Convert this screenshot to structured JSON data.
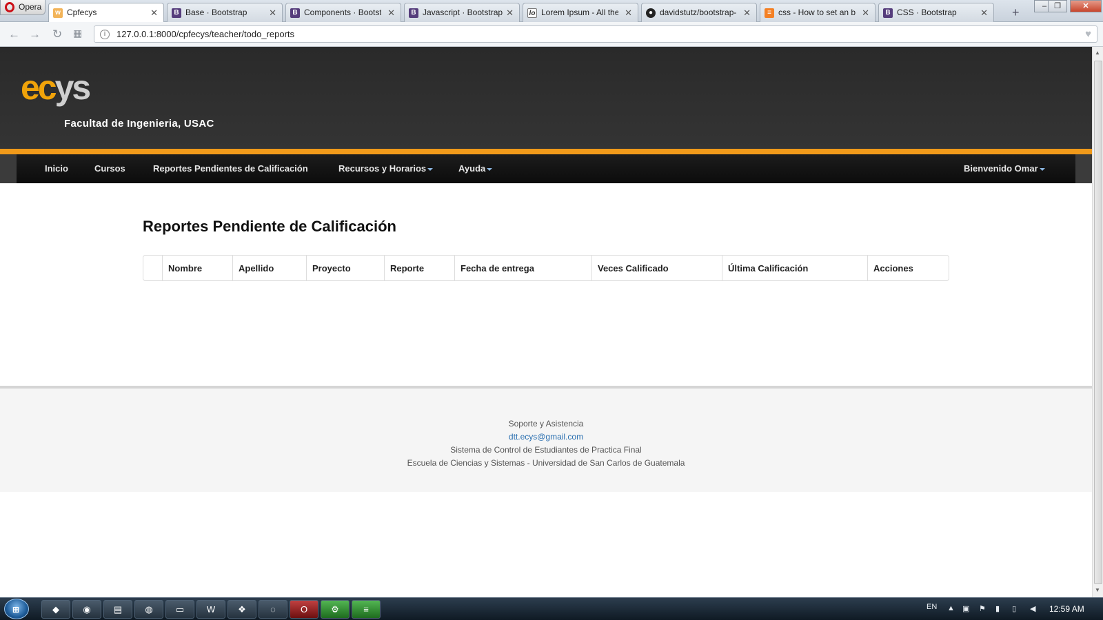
{
  "browser": {
    "menu_label": "Opera",
    "tabs": [
      {
        "title": "Cpfecys",
        "favicon": "wsp"
      },
      {
        "title": "Base · Bootstrap",
        "favicon": "B"
      },
      {
        "title": "Components · Bootstrap",
        "favicon": "B"
      },
      {
        "title": "Javascript · Bootstrap",
        "favicon": "B"
      },
      {
        "title": "Lorem Ipsum - All the facts",
        "favicon": "lor"
      },
      {
        "title": "davidstutz/bootstrap-multiselect",
        "favicon": "github"
      },
      {
        "title": "css - How to set an button",
        "favicon": "stackoverflow"
      },
      {
        "title": "CSS · Bootstrap",
        "favicon": "B"
      }
    ],
    "new_tab_icon": "+",
    "url": "127.0.0.1:8000/cpfecys/teacher/todo_reports"
  },
  "header": {
    "logo_accent": "ec",
    "logo_rest": "ys",
    "subtitle": "Facultad de Ingenieria, USAC",
    "accent_color": "#f19a1a"
  },
  "nav": {
    "items": [
      {
        "label": "Inicio"
      },
      {
        "label": "Cursos"
      },
      {
        "label": "Reportes Pendientes de Calificación"
      },
      {
        "label": "Recursos y Horarios"
      },
      {
        "label": "Ayuda"
      }
    ],
    "user_menu": "Bienvenido Omar"
  },
  "main": {
    "title": "Reportes Pendiente de Calificación",
    "table": {
      "headers": [
        "",
        "Nombre",
        "Apellido",
        "Proyecto",
        "Reporte",
        "Fecha de entrega",
        "Veces Calificado",
        "Última Calificación",
        "Acciones"
      ]
    }
  },
  "footer": {
    "line1": "Soporte y Asistencia",
    "email": "dtt.ecys@gmail.com",
    "line3": "Sistema de Control de Estudiantes de Practica Final",
    "line4": "Escuela de Ciencias y Sistemas - Universidad de San Carlos de Guatemala"
  },
  "taskbar": {
    "language": "EN",
    "clock": "12:59 AM"
  }
}
